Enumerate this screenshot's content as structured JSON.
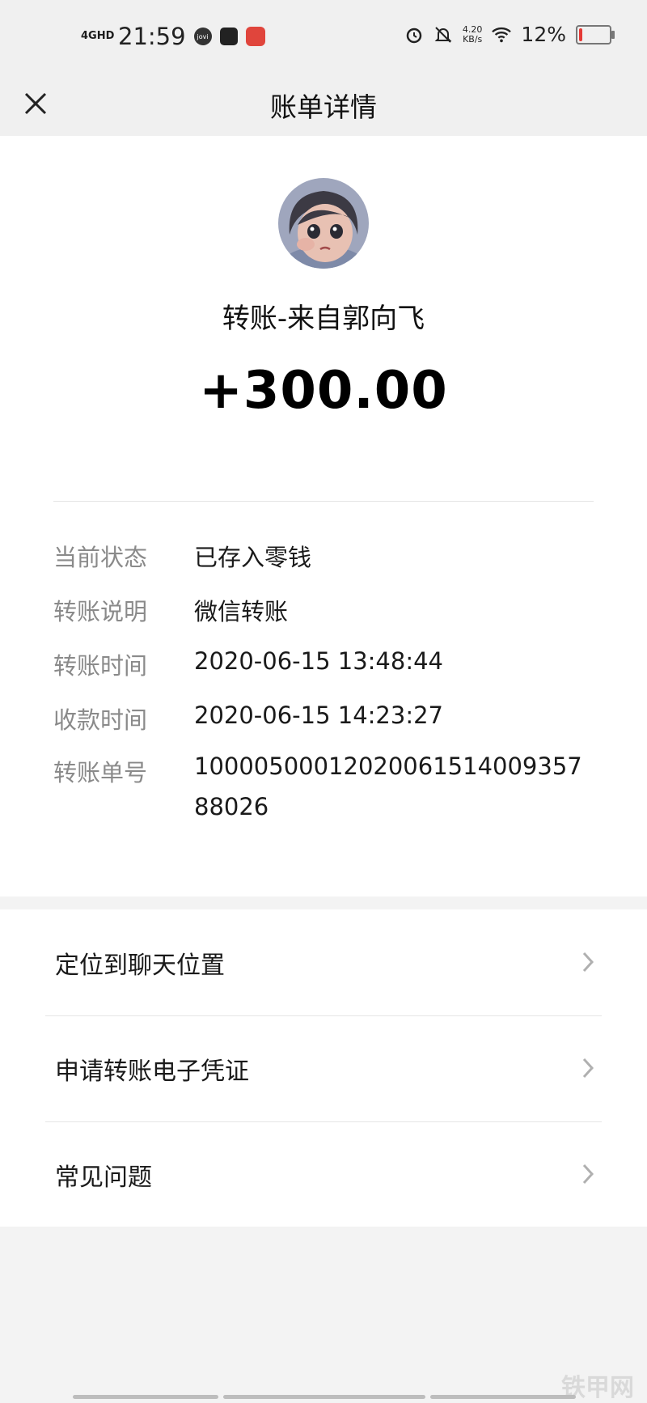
{
  "status_bar": {
    "network": "4GHD",
    "time": "21:59",
    "speed_value": "4.20",
    "speed_unit": "KB/s",
    "battery": "12%",
    "battery_level": 0.12
  },
  "nav": {
    "title": "账单详情"
  },
  "transfer": {
    "payer": "转账-来自郭向飞",
    "amount": "+300.00"
  },
  "details": [
    {
      "label": "当前状态",
      "value": "已存入零钱"
    },
    {
      "label": "转账说明",
      "value": "微信转账"
    },
    {
      "label": "转账时间",
      "value": "2020-06-15 13:48:44"
    },
    {
      "label": "收款时间",
      "value": "2020-06-15 14:23:27"
    },
    {
      "label": "转账单号",
      "value": "10000500012020061514009357880​26"
    }
  ],
  "menu": [
    {
      "label": "定位到聊天位置"
    },
    {
      "label": "申请转账电子凭证"
    },
    {
      "label": "常见问题"
    }
  ],
  "watermark": "铁甲网",
  "colors": {
    "background": "#f3f3f3",
    "card": "#ffffff",
    "label_gray": "#8a8a8a",
    "battery_red": "#e53935"
  }
}
